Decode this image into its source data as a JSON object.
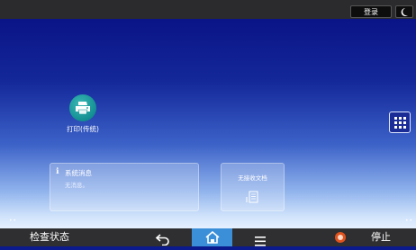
{
  "topbar": {
    "login_label": "登录",
    "night_mode_icon": "moon-icon"
  },
  "desktop": {
    "apps": [
      {
        "label": "打印(传统)",
        "icon": "printer-icon",
        "color": "#16969a"
      }
    ],
    "app_list_icon": "grid-icon",
    "system_message": {
      "icon": "info-icon",
      "title": "系统消息",
      "message": "无消息。"
    },
    "fax_widget": {
      "label": "无接收文档",
      "icon": "fax-document-icon"
    },
    "page_dots": "••"
  },
  "bottombar": {
    "check_status_label": "检查状态",
    "back_icon": "back-icon",
    "home_icon": "home-icon",
    "menu_icon": "menu-icon",
    "stop_label": "停止",
    "stop_icon": "stop-icon",
    "home_color": "#3b8ed8",
    "stop_color": "#e1521d"
  }
}
